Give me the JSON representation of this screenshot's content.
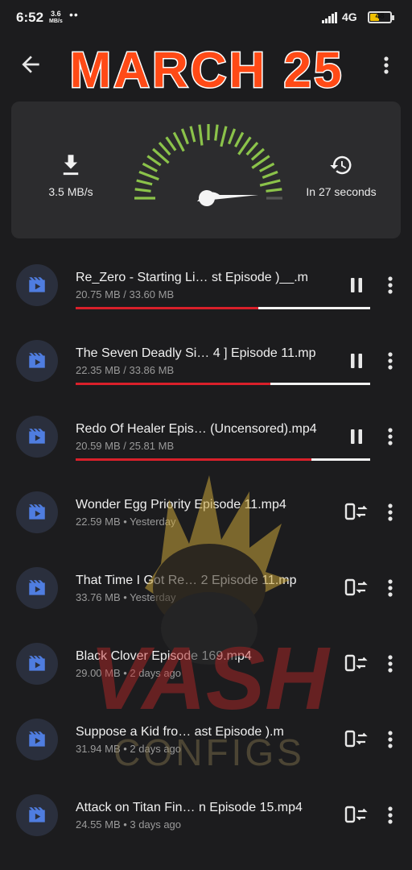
{
  "status_bar": {
    "time": "6:52",
    "speed_value": "3.6",
    "speed_unit": "MB/s",
    "dots": "••",
    "network": "4G",
    "battery": "48"
  },
  "header": {
    "banner_text": "MARCH 25"
  },
  "speed_card": {
    "download_speed": "3.5 MB/s",
    "eta": "In 27 seconds"
  },
  "downloads": [
    {
      "name": "Re_Zero - Starting Li…   st Episode )__.m",
      "meta": "20.75 MB / 33.60 MB",
      "progress": 0.62,
      "state": "downloading"
    },
    {
      "name": "The Seven Deadly Si…   4 ] Episode 11.mp",
      "meta": "22.35 MB / 33.86 MB",
      "progress": 0.66,
      "state": "downloading"
    },
    {
      "name": "Redo Of Healer Epis… (Uncensored).mp4",
      "meta": "20.59 MB / 25.81 MB",
      "progress": 0.8,
      "state": "downloading"
    },
    {
      "name": "Wonder Egg Priority Episode 11.mp4",
      "meta": "22.59 MB  •  Yesterday",
      "state": "done"
    },
    {
      "name": "That Time I Got Re…   2 Episode 11.mp",
      "meta": "33.76 MB  •  Yesterday",
      "state": "done"
    },
    {
      "name": "Black Clover Episode 169.mp4",
      "meta": "29.00 MB  •  2 days ago",
      "state": "done"
    },
    {
      "name": "Suppose a Kid fro…     ast Episode ).m",
      "meta": "31.94 MB  •  2 days ago",
      "state": "done"
    },
    {
      "name": "Attack on Titan Fin… n Episode 15.mp4",
      "meta": "24.55 MB  •  3 days ago",
      "state": "done"
    }
  ],
  "watermark": {
    "line1": "VASH",
    "line2": "CONFIGS"
  },
  "icons": {
    "back": "back-arrow-icon",
    "more": "more-vert-icon",
    "download": "download-icon",
    "history": "history-icon",
    "video": "video-file-icon",
    "pause": "pause-icon",
    "open_in_app": "open-in-app-icon"
  },
  "colors": {
    "progress": "#d9202a",
    "banner": "#ff4a16",
    "gauge": "#8bc34a",
    "icon_blue": "#4f7de0"
  }
}
